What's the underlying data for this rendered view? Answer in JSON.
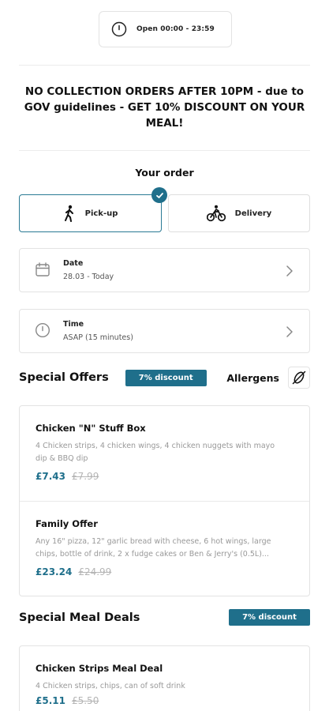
{
  "hours": {
    "text": "Open 00:00 - 23:59",
    "icon": "clock-icon"
  },
  "notice": "NO COLLECTION ORDERS AFTER 10PM - due to GOV guidelines - GET 10% DISCOUNT ON YOUR MEAL!",
  "order": {
    "title": "Your order",
    "modes": [
      {
        "label": "Pick-up",
        "icon": "walking-person-icon",
        "selected": true
      },
      {
        "label": "Delivery",
        "icon": "bicycle-icon",
        "selected": false
      }
    ],
    "date": {
      "label": "Date",
      "value": "28.03 - Today"
    },
    "time": {
      "label": "Time",
      "value": "ASAP (15 minutes)"
    }
  },
  "special_offers": {
    "title": "Special Offers",
    "badge": "7% discount",
    "allergens_label": "Allergens",
    "items": [
      {
        "name": "Chicken \"N\" Stuff Box",
        "description": "4 Chicken strips, 4 chicken wings, 4 chicken nuggets with mayo dip & BBQ dip",
        "price": "£7.43",
        "old_price": "£7.99"
      },
      {
        "name": "Family Offer",
        "description": "Any 16\" pizza, 12\" garlic bread with cheese, 6 hot wings, large chips, bottle of drink, 2 x fudge cakes or Ben & Jerry's (0.5L)...",
        "price": "£23.24",
        "old_price": "£24.99"
      }
    ]
  },
  "meal_deals": {
    "title": "Special Meal Deals",
    "badge": "7% discount",
    "items": [
      {
        "name": "Chicken Strips Meal Deal",
        "description": "4 Chicken strips, chips, can of soft drink",
        "price": "£5.11",
        "old_price": "£5.50"
      }
    ]
  },
  "colors": {
    "accent": "#1f6f8b",
    "muted": "#999999",
    "border": "#e3e3e3"
  }
}
